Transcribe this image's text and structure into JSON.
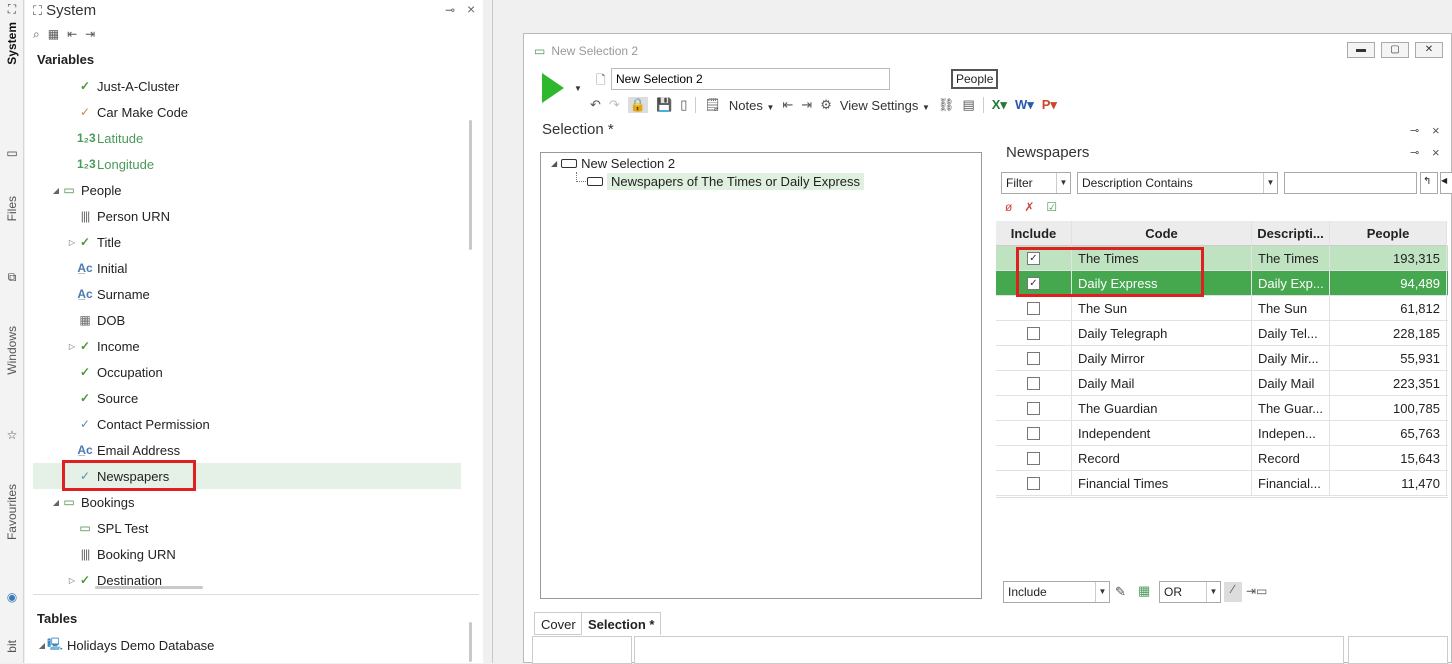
{
  "vtabs": [
    {
      "label": "System",
      "icon": "hierarchy-icon"
    },
    {
      "label": "Files",
      "icon": "folder-icon"
    },
    {
      "label": "Windows",
      "icon": "windows-icon"
    },
    {
      "label": "Favourites",
      "icon": "star-icon"
    },
    {
      "label": "bit",
      "icon": "target-icon"
    }
  ],
  "system_panel": {
    "title": "System",
    "pin_glyph": "⊸",
    "close_glyph": "×",
    "variables_title": "Variables",
    "tables_title": "Tables",
    "tree": [
      {
        "label": "Just-A-Cluster",
        "icon": "check-icon",
        "level": 2
      },
      {
        "label": "Car Make Code",
        "icon": "dual-check-icon",
        "level": 2
      },
      {
        "label": "Latitude",
        "icon": "numeric-icon",
        "level": 2,
        "green": true
      },
      {
        "label": "Longitude",
        "icon": "numeric-icon",
        "level": 2,
        "green": true
      },
      {
        "label": "People",
        "icon": "folder-icon",
        "level": 1,
        "expanded": true
      },
      {
        "label": "Person URN",
        "icon": "barcode-icon",
        "level": 2
      },
      {
        "label": "Title",
        "icon": "check-icon",
        "level": 2,
        "collapsed": true
      },
      {
        "label": "Initial",
        "icon": "text-icon",
        "level": 2
      },
      {
        "label": "Surname",
        "icon": "text-icon",
        "level": 2
      },
      {
        "label": "DOB",
        "icon": "calendar-icon",
        "level": 2
      },
      {
        "label": "Income",
        "icon": "check-icon",
        "level": 2,
        "collapsed": true
      },
      {
        "label": "Occupation",
        "icon": "check-icon",
        "level": 2
      },
      {
        "label": "Source",
        "icon": "check-icon",
        "level": 2
      },
      {
        "label": "Contact Permission",
        "icon": "multi-check-icon",
        "level": 2
      },
      {
        "label": "Email Address",
        "icon": "text-icon",
        "level": 2
      },
      {
        "label": "Newspapers",
        "icon": "multi-check-icon",
        "level": 2,
        "selected": true
      },
      {
        "label": "Bookings",
        "icon": "folder-icon",
        "level": 1,
        "expanded": true
      },
      {
        "label": "SPL Test",
        "icon": "folder-icon",
        "level": 2
      },
      {
        "label": "Booking URN",
        "icon": "barcode-icon",
        "level": 2
      },
      {
        "label": "Destination",
        "icon": "check-icon",
        "level": 2,
        "collapsed": true
      }
    ],
    "tables": [
      {
        "label": "Holidays Demo Database",
        "icon": "database-icon"
      }
    ]
  },
  "window": {
    "title": "New Selection 2",
    "selection_name": "New Selection 2",
    "people_button": "People",
    "notes_label": "Notes",
    "view_settings_label": "View Settings",
    "selection_heading": "Selection *",
    "selection_tree": {
      "root": "New Selection 2",
      "child": "Newspapers of The Times or Daily Express"
    }
  },
  "newspapers_panel": {
    "title": "Newspapers",
    "filter_value": "Filter",
    "filter_mode": "Description Contains",
    "filter_text": "",
    "columns": [
      "Include",
      "Code",
      "Descripti...",
      "People"
    ],
    "rows": [
      {
        "code": "The Times",
        "desc": "The Times",
        "people": "193,315",
        "included": true,
        "state": "light"
      },
      {
        "code": "Daily Express",
        "desc": "Daily Exp...",
        "people": "94,489",
        "included": true,
        "state": "dark"
      },
      {
        "code": "The Sun",
        "desc": "The Sun",
        "people": "61,812",
        "included": false
      },
      {
        "code": "Daily Telegraph",
        "desc": "Daily Tel...",
        "people": "228,185",
        "included": false
      },
      {
        "code": "Daily Mirror",
        "desc": "Daily Mir...",
        "people": "55,931",
        "included": false
      },
      {
        "code": "Daily Mail",
        "desc": "Daily Mail",
        "people": "223,351",
        "included": false
      },
      {
        "code": "The Guardian",
        "desc": "The Guar...",
        "people": "100,785",
        "included": false
      },
      {
        "code": "Independent",
        "desc": "Indepen...",
        "people": "65,763",
        "included": false
      },
      {
        "code": "Record",
        "desc": "Record",
        "people": "15,643",
        "included": false
      },
      {
        "code": "Financial Times",
        "desc": "Financial...",
        "people": "11,470",
        "included": false
      }
    ],
    "include_mode": "Include",
    "logic": "OR"
  },
  "doc_tabs": [
    "Cover",
    "Selection *"
  ],
  "colors": {
    "row_light": "#bfe3c0",
    "row_dark": "#45a84f",
    "highlight_red": "#e02020",
    "run_green": "#2eb82e"
  }
}
